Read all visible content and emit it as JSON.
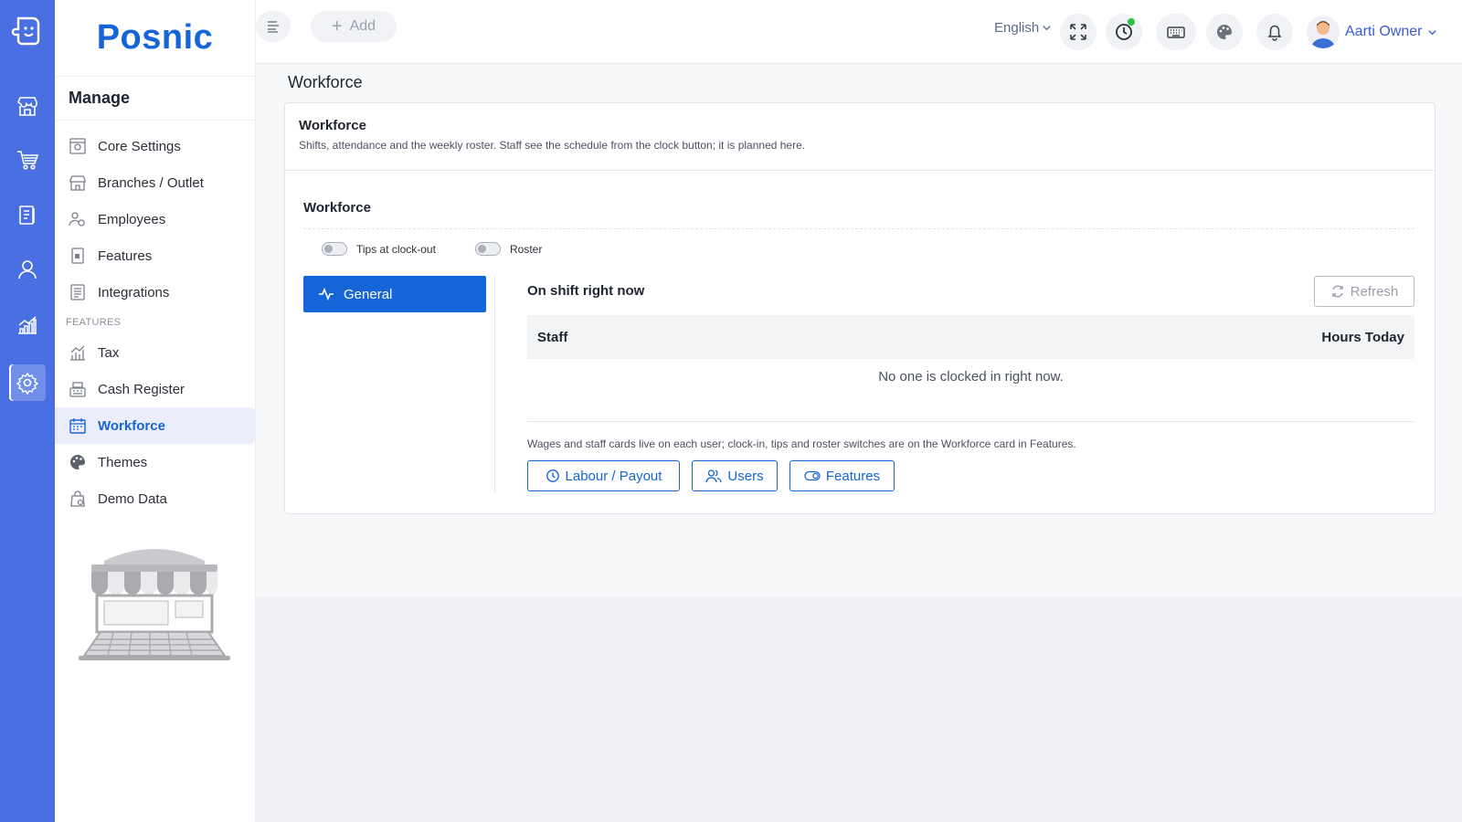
{
  "app": {
    "brand": "Posnic"
  },
  "topbar": {
    "add_label": "Add",
    "language": "English",
    "user_name": "Aarti Owner"
  },
  "sidebar": {
    "title": "Manage",
    "items": [
      {
        "label": "Core Settings",
        "icon": "settings-panel-icon"
      },
      {
        "label": "Branches / Outlet",
        "icon": "store-icon"
      },
      {
        "label": "Employees",
        "icon": "users-gear-icon"
      },
      {
        "label": "Features",
        "icon": "feature-doc-icon"
      },
      {
        "label": "Integrations",
        "icon": "list-doc-icon"
      }
    ],
    "section_label": "FEATURES",
    "feature_items": [
      {
        "label": "Tax",
        "icon": "chart-icon"
      },
      {
        "label": "Cash Register",
        "icon": "register-icon"
      },
      {
        "label": "Workforce",
        "icon": "calendar-icon",
        "active": true
      },
      {
        "label": "Themes",
        "icon": "palette-icon"
      },
      {
        "label": "Demo Data",
        "icon": "bag-icon"
      }
    ]
  },
  "page": {
    "title": "Workforce",
    "card_title": "Workforce",
    "card_description": "Shifts, attendance and the weekly roster. Staff see the schedule from the clock button; it is planned here.",
    "section_title": "Workforce",
    "toggles": [
      {
        "label": "Tips at clock-out",
        "on": false
      },
      {
        "label": "Roster",
        "on": false
      }
    ],
    "tabs": [
      {
        "label": "General",
        "active": true
      }
    ],
    "pane": {
      "title": "On shift right now",
      "refresh_label": "Refresh",
      "columns": [
        "Staff",
        "Hours Today"
      ],
      "empty_message": "No one is clocked in right now.",
      "note": "Wages and staff cards live on each user; clock-in, tips and roster switches are on the Workforce card in Features.",
      "buttons": [
        {
          "label": "Labour / Payout",
          "icon": "clock-icon"
        },
        {
          "label": "Users",
          "icon": "users-icon"
        },
        {
          "label": "Features",
          "icon": "toggle-icon"
        }
      ]
    }
  },
  "colors": {
    "rail": "#4a6fe3",
    "primary": "#1565d8",
    "active_nav_bg": "#ebedfb",
    "online_dot": "#2fbf4a"
  }
}
